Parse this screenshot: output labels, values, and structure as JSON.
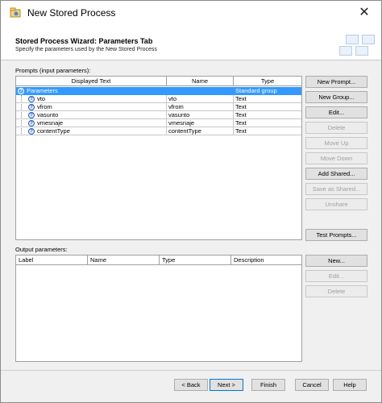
{
  "window": {
    "title": "New Stored Process",
    "close_label": "✕"
  },
  "header": {
    "title": "Stored Process Wizard: Parameters Tab",
    "subtitle": "Specify the parameters used by the New Stored Process"
  },
  "prompts": {
    "label": "Prompts (input parameters):",
    "columns": [
      "Displayed Text",
      "Name",
      "Type"
    ],
    "group": {
      "text": "Parameters",
      "name": "",
      "type": "Standard group"
    },
    "rows": [
      {
        "text": "vto",
        "name": "vto",
        "type": "Text"
      },
      {
        "text": "vfrom",
        "name": "vfrom",
        "type": "Text"
      },
      {
        "text": "vasunto",
        "name": "vasunto",
        "type": "Text"
      },
      {
        "text": "vmesnaje",
        "name": "vmesnaje",
        "type": "Text"
      },
      {
        "text": "contentType",
        "name": "contentType",
        "type": "Text"
      }
    ],
    "buttons": {
      "new_prompt": "New Prompt...",
      "new_group": "New Group...",
      "edit": "Edit...",
      "delete": "Delete",
      "move_up": "Move Up",
      "move_down": "Move Down",
      "add_shared": "Add Shared...",
      "save_as_shared": "Save as Shared...",
      "unshare": "Unshare",
      "test_prompts": "Test Prompts..."
    }
  },
  "output": {
    "label": "Output parameters:",
    "columns": [
      "Label",
      "Name",
      "Type",
      "Description"
    ],
    "buttons": {
      "new": "New...",
      "edit": "Edit...",
      "delete": "Delete"
    }
  },
  "footer": {
    "back": "< Back",
    "next": "Next >",
    "finish": "Finish",
    "cancel": "Cancel",
    "help": "Help"
  },
  "colors": {
    "selection": "#3399ff",
    "accent": "#0078d7"
  }
}
